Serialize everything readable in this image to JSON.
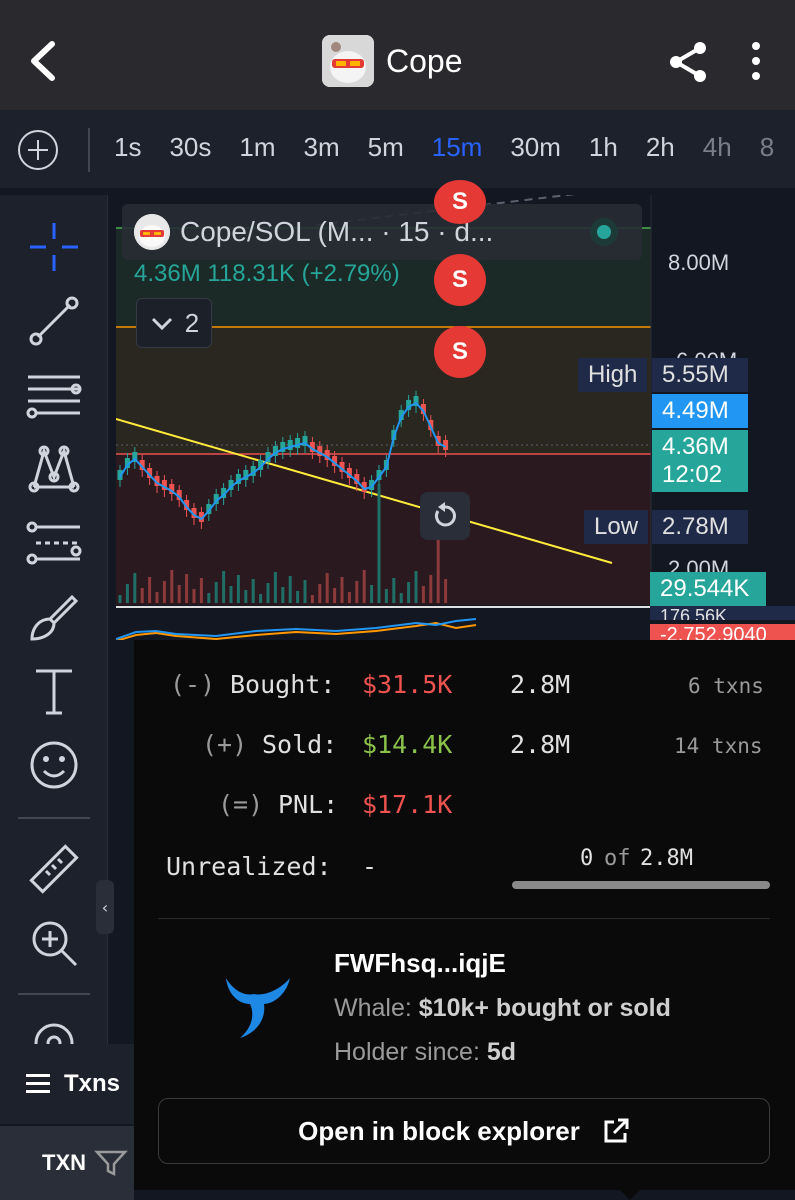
{
  "header": {
    "title": "Cope",
    "back_icon": "chevron-left-icon",
    "share_icon": "share-icon",
    "more_icon": "more-vertical-icon"
  },
  "timeframes": {
    "items": [
      "1s",
      "30s",
      "1m",
      "3m",
      "5m",
      "15m",
      "30m",
      "1h",
      "2h",
      "4h",
      "8"
    ],
    "active": "15m"
  },
  "chart": {
    "legend_title": "Cope/SOL (M... · 15 · d...",
    "volume_line": "4.36M  118.31K (+2.79%)",
    "collapse_count": "2",
    "axis": {
      "label_8m": "8.00M",
      "label_6m": "6.00M",
      "label_2m": "2.00M",
      "label_vol": "176.56K",
      "label_osc": "-2,752.9040"
    },
    "tags": {
      "high_label": "High",
      "high_value": "5.55M",
      "blue_value": "4.49M",
      "last_value": "4.36M",
      "countdown": "12:02",
      "low_label": "Low",
      "low_value": "2.78M",
      "volume_value": "29.544K"
    },
    "signals": [
      "S",
      "S",
      "S"
    ]
  },
  "popup": {
    "bought": {
      "sign": "(-)",
      "label": "Bought:",
      "usd": "$31.5K",
      "amount": "2.8M",
      "txns": "6 txns"
    },
    "sold": {
      "sign": "(+)",
      "label": "Sold:",
      "usd": "$14.4K",
      "amount": "2.8M",
      "txns": "14 txns"
    },
    "pnl": {
      "sign": "(=)",
      "label": "PNL:",
      "usd": "$17.1K"
    },
    "unrealized": {
      "label": "Unrealized:",
      "value": "-",
      "held": "0",
      "of": "of",
      "total": "2.8M"
    },
    "holder": {
      "address": "FWFhsq...iqjE",
      "whale_prefix": "Whale:",
      "whale_desc": "$10k+ bought or sold",
      "since_prefix": "Holder since:",
      "since_value": "5d"
    },
    "explorer_button": "Open in block explorer"
  },
  "bottom": {
    "tab_label": "Txns",
    "column_label": "TXN"
  },
  "colors": {
    "accent": "#2962ff",
    "up": "#26a69a",
    "down": "#ef5350",
    "whale": "#1e88e5"
  }
}
